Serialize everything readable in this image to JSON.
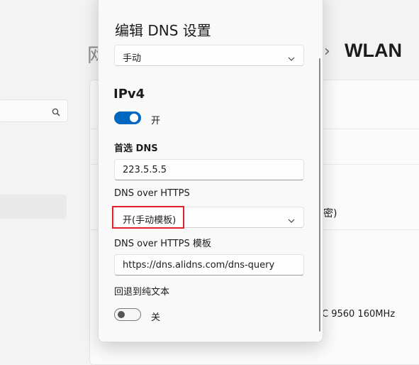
{
  "background": {
    "title_fragment": "网",
    "breadcrumb_sep": "›",
    "breadcrumb_current": "WLAN",
    "encryption_fragment": "密)",
    "adapter_fragment": "C 9560 160MHz"
  },
  "dialog": {
    "title": "编辑 DNS 设置",
    "mode_select": "手动",
    "ipv4": {
      "heading": "IPv4",
      "toggle_state": "开",
      "preferred_dns_label": "首选 DNS",
      "preferred_dns_value": "223.5.5.5",
      "doh_label": "DNS over HTTPS",
      "doh_value": "开(手动模板)",
      "doh_template_label": "DNS over HTTPS 模板",
      "doh_template_value": "https://dns.alidns.com/dns-query",
      "fallback_label": "回退到纯文本",
      "fallback_state": "关"
    }
  },
  "colors": {
    "accent": "#0067c0",
    "highlight": "#e0202a"
  },
  "icons": {
    "search": "search-icon",
    "chevron": "chevron-down-icon"
  }
}
